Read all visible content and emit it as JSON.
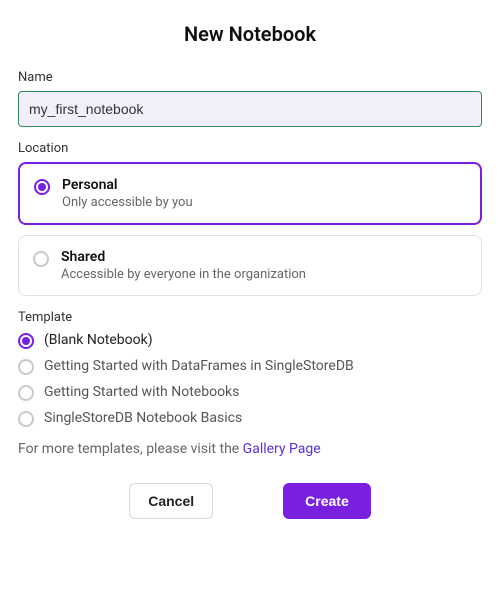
{
  "title": "New Notebook",
  "name": {
    "label": "Name",
    "value": "my_first_notebook"
  },
  "location": {
    "label": "Location",
    "options": [
      {
        "title": "Personal",
        "desc": "Only accessible by you",
        "selected": true
      },
      {
        "title": "Shared",
        "desc": "Accessible by everyone in the organization",
        "selected": false
      }
    ]
  },
  "template": {
    "label": "Template",
    "options": [
      {
        "label": "(Blank Notebook)",
        "selected": true
      },
      {
        "label": "Getting Started with DataFrames in SingleStoreDB",
        "selected": false
      },
      {
        "label": "Getting Started with Notebooks",
        "selected": false
      },
      {
        "label": "SingleStoreDB Notebook Basics",
        "selected": false
      }
    ],
    "more_prefix": "For more templates, please visit the ",
    "more_link": "Gallery Page"
  },
  "buttons": {
    "cancel": "Cancel",
    "create": "Create"
  }
}
